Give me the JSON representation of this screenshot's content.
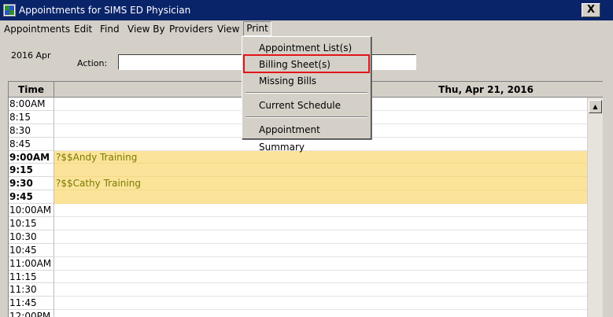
{
  "window": {
    "title": "Appointments for SIMS ED Physician",
    "close_glyph": "X"
  },
  "menu": {
    "items": [
      "Appointments",
      "Edit",
      "Find",
      "View By",
      "Providers",
      "View"
    ],
    "active": "Print"
  },
  "print_menu": {
    "items": [
      "Appointment List(s)",
      "Billing Sheet(s)",
      "Missing Bills",
      "Current Schedule",
      "Appointment Summary"
    ],
    "highlighted_item": "Billing Sheet(s)",
    "highlight_color": "#e3151a"
  },
  "toolbar": {
    "date": "2016 Apr",
    "action_label": "Action:",
    "action_value": ""
  },
  "schedule": {
    "time_header": "Time",
    "day_header": "Thu, Apr 21, 2016",
    "booked_color": "#fbe49a",
    "rows": [
      {
        "time": "8:00AM",
        "bold": false,
        "appointment": "",
        "booked": false
      },
      {
        "time": "8:15",
        "bold": false,
        "appointment": "",
        "booked": false
      },
      {
        "time": "8:30",
        "bold": false,
        "appointment": "",
        "booked": false
      },
      {
        "time": "8:45",
        "bold": false,
        "appointment": "",
        "booked": false
      },
      {
        "time": "9:00AM",
        "bold": true,
        "appointment": "?$$Andy Training",
        "booked": true
      },
      {
        "time": "9:15",
        "bold": true,
        "appointment": "",
        "booked": true
      },
      {
        "time": "9:30",
        "bold": true,
        "appointment": "?$$Cathy Training",
        "booked": true
      },
      {
        "time": "9:45",
        "bold": true,
        "appointment": "",
        "booked": true
      },
      {
        "time": "10:00AM",
        "bold": false,
        "appointment": "",
        "booked": false
      },
      {
        "time": "10:15",
        "bold": false,
        "appointment": "",
        "booked": false
      },
      {
        "time": "10:30",
        "bold": false,
        "appointment": "",
        "booked": false
      },
      {
        "time": "10:45",
        "bold": false,
        "appointment": "",
        "booked": false
      },
      {
        "time": "11:00AM",
        "bold": false,
        "appointment": "",
        "booked": false
      },
      {
        "time": "11:15",
        "bold": false,
        "appointment": "",
        "booked": false
      },
      {
        "time": "11:30",
        "bold": false,
        "appointment": "",
        "booked": false
      },
      {
        "time": "11:45",
        "bold": false,
        "appointment": "",
        "booked": false
      },
      {
        "time": "12:00PM",
        "bold": false,
        "appointment": "",
        "booked": false
      }
    ]
  }
}
